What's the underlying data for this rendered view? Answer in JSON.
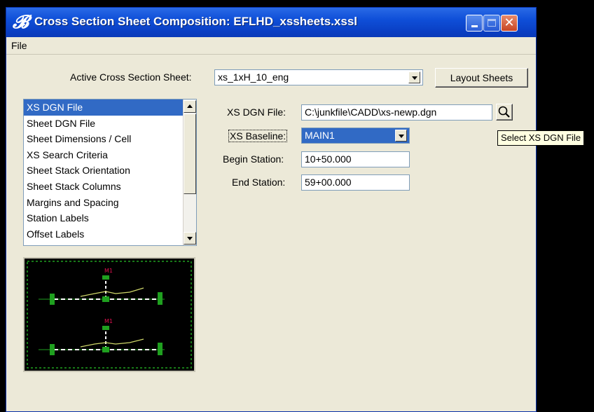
{
  "window": {
    "title": "Cross Section Sheet Composition: EFLHD_xssheets.xssl"
  },
  "menu": {
    "file": "File"
  },
  "active_sheet": {
    "label": "Active Cross Section Sheet:",
    "value": "xs_1xH_10_eng"
  },
  "layout_button": "Layout Sheets",
  "categories": [
    "XS DGN File",
    "Sheet DGN File",
    "Sheet Dimensions / Cell",
    "XS Search Criteria",
    "Sheet Stack Orientation",
    "Sheet Stack Columns",
    "Margins and Spacing",
    "Station Labels",
    "Offset Labels"
  ],
  "selected_category": "XS DGN File",
  "form": {
    "xs_dgn_file_label": "XS DGN File:",
    "xs_dgn_file_value": "C:\\junkfile\\CADD\\xs-newp.dgn",
    "xs_baseline_label": "XS Baseline:",
    "xs_baseline_value": "MAIN1",
    "begin_station_label": "Begin Station:",
    "begin_station_value": "10+50.000",
    "end_station_label": "End Station:",
    "end_station_value": "59+00.000"
  },
  "tooltip": "Select XS DGN File",
  "preview": {
    "top_label": "M1",
    "bottom_label": "M1"
  },
  "colors": {
    "titlebar": "#0a3fc4",
    "selection": "#316ac5",
    "dialog_bg": "#ece9d8",
    "preview_border": "#1fa01f",
    "preview_marker_label": "#e01050"
  }
}
